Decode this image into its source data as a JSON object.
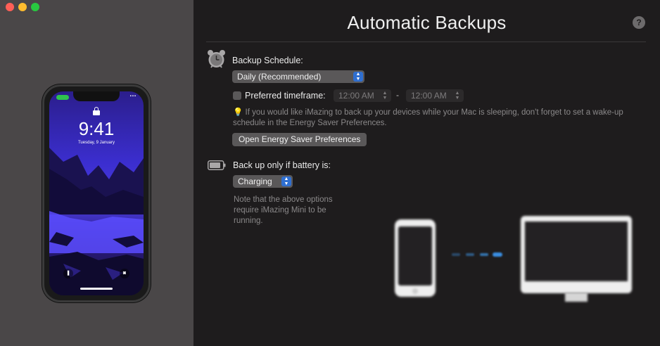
{
  "window": {
    "title": "Automatic Backups"
  },
  "phone_preview": {
    "time": "9:41",
    "date": "Tuesday, 9 January"
  },
  "help": {
    "label": "?"
  },
  "schedule": {
    "label": "Backup Schedule:",
    "selected": "Daily (Recommended)",
    "preferred_label": "Preferred timeframe:",
    "preferred_checked": false,
    "from_time": "12:00 AM",
    "to_time": "12:00 AM",
    "separator": "-",
    "tip": "If you would like iMazing to back up your devices while your Mac is sleeping, don't forget to set a wake-up schedule in the Energy Saver Preferences.",
    "energy_button": "Open Energy Saver Preferences"
  },
  "battery": {
    "label": "Back up only if battery is:",
    "selected": "Charging",
    "note": "Note that the above options require iMazing Mini to be running."
  },
  "colors": {
    "accent": "#2f6fd1",
    "transfer_arrow": "#3a8de0"
  }
}
